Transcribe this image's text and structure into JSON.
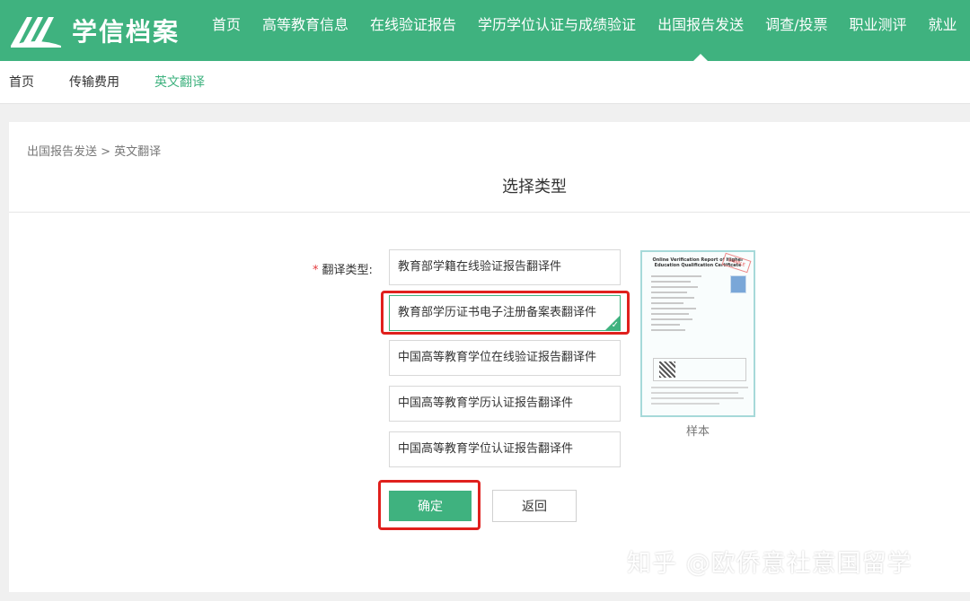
{
  "header": {
    "logo_text": "学信档案",
    "nav": [
      "首页",
      "高等教育信息",
      "在线验证报告",
      "学历学位认证与成绩验证",
      "出国报告发送",
      "调查/投票",
      "职业测评",
      "就业"
    ],
    "active_nav_index": 4
  },
  "subnav": {
    "items": [
      "首页",
      "传输费用",
      "英文翻译"
    ],
    "active_index": 2
  },
  "breadcrumb": "出国报告发送 > 英文翻译",
  "section_title": "选择类型",
  "form": {
    "required_mark": "*",
    "label": "翻译类型:",
    "options": [
      "教育部学籍在线验证报告翻译件",
      "教育部学历证书电子注册备案表翻译件",
      "中国高等教育学位在线验证报告翻译件",
      "中国高等教育学历认证报告翻译件",
      "中国高等教育学位认证报告翻译件"
    ],
    "selected_index": 1,
    "check_icon": "checkmark-icon"
  },
  "sample": {
    "title": "Online Verification Report of Higher Education Qualification Certificate",
    "stamp": "SAMPLE",
    "caption": "样本"
  },
  "buttons": {
    "confirm": "确定",
    "back": "返回"
  },
  "watermark": "知乎 @欧侨意社意国留学",
  "colors": {
    "brand": "#3fb27f",
    "highlight": "#e0201d"
  }
}
